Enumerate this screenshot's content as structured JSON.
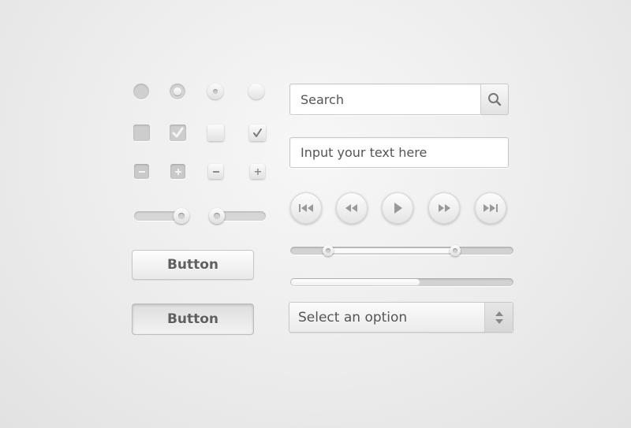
{
  "radios": [
    {
      "state": "filled"
    },
    {
      "state": "selected"
    },
    {
      "state": "selected-raised"
    },
    {
      "state": "unselected-raised"
    }
  ],
  "checkboxes": [
    {
      "checked": false,
      "style": "inset"
    },
    {
      "checked": true,
      "style": "inset"
    },
    {
      "checked": false,
      "style": "raised"
    },
    {
      "checked": true,
      "style": "raised"
    }
  ],
  "toggles": [
    {
      "symbol": "−",
      "style": "inset"
    },
    {
      "symbol": "+",
      "style": "inset"
    },
    {
      "symbol": "−",
      "style": "raised"
    },
    {
      "symbol": "+",
      "style": "raised"
    }
  ],
  "small_sliders": [
    {
      "value": 0.85
    },
    {
      "value": 0.12
    }
  ],
  "buttons": {
    "primary_label": "Button",
    "pressed_label": "Button"
  },
  "search": {
    "placeholder": "Search",
    "icon": "search-icon"
  },
  "text_input": {
    "placeholder": "Input your text here"
  },
  "media_controls": [
    {
      "name": "skip-back",
      "icon": "skip-back-icon"
    },
    {
      "name": "rewind",
      "icon": "rewind-icon"
    },
    {
      "name": "play",
      "icon": "play-icon"
    },
    {
      "name": "fast-forward",
      "icon": "fast-forward-icon"
    },
    {
      "name": "skip-forward",
      "icon": "skip-forward-icon"
    }
  ],
  "range_slider": {
    "low": 0.17,
    "high": 0.74
  },
  "progress": {
    "value": 0.58
  },
  "select": {
    "selected": "Select an option",
    "icon": "up-down-arrows-icon"
  },
  "colors": {
    "background": "#ececec",
    "control_light": "#fdfdfd",
    "control_dark": "#cfcfcf",
    "text": "#555555"
  }
}
